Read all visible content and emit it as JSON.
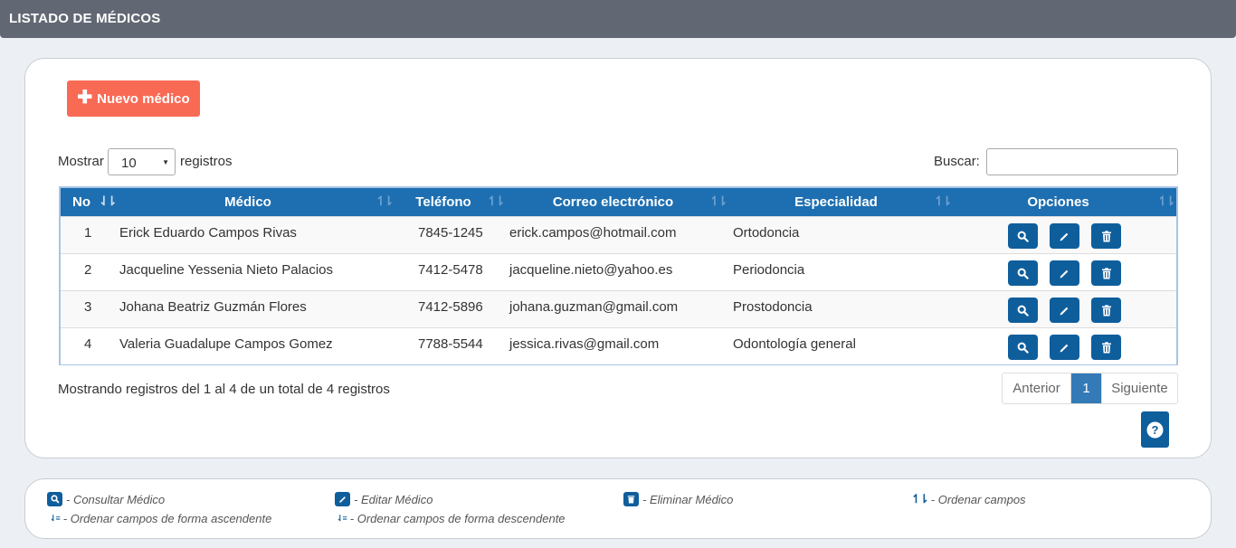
{
  "header": {
    "title": "LISTADO DE MÉDICOS"
  },
  "toolbar": {
    "new_label": "Nuevo médico",
    "new_icon": "plus-icon"
  },
  "length": {
    "prefix": "Mostrar",
    "value": "10",
    "suffix": "registros"
  },
  "search": {
    "label": "Buscar:",
    "value": "",
    "placeholder": ""
  },
  "table": {
    "columns": [
      "No",
      "Médico",
      "Teléfono",
      "Correo electrónico",
      "Especialidad",
      "Opciones"
    ],
    "rows": [
      {
        "no": "1",
        "medico": "Erick Eduardo Campos Rivas",
        "telefono": "7845-1245",
        "correo": "erick.campos@hotmail.com",
        "especialidad": "Ortodoncia"
      },
      {
        "no": "2",
        "medico": "Jacqueline Yessenia Nieto Palacios",
        "telefono": "7412-5478",
        "correo": "jacqueline.nieto@yahoo.es",
        "especialidad": "Periodoncia"
      },
      {
        "no": "3",
        "medico": "Johana Beatriz Guzmán Flores",
        "telefono": "7412-5896",
        "correo": "johana.guzman@gmail.com",
        "especialidad": "Prostodoncia"
      },
      {
        "no": "4",
        "medico": "Valeria Guadalupe Campos Gomez",
        "telefono": "7788-5544",
        "correo": "jessica.rivas@gmail.com",
        "especialidad": "Odontología general"
      }
    ]
  },
  "footer": {
    "info": "Mostrando registros del 1 al 4 de un total de 4 registros",
    "prev": "Anterior",
    "page": "1",
    "next": "Siguiente"
  },
  "legend": {
    "consult": "- Consultar Médico",
    "edit": "- Editar Médico",
    "delete": "- Eliminar Médico",
    "sort": "- Ordenar campos",
    "asc": "- Ordenar campos de forma ascendente",
    "desc": "- Ordenar campos de forma descendente"
  },
  "colors": {
    "header_bg": "#626873",
    "accent": "#f96a55",
    "table_header": "#1d6fb1",
    "icon_button": "#0f5e9c",
    "page_active": "#337ab7"
  }
}
